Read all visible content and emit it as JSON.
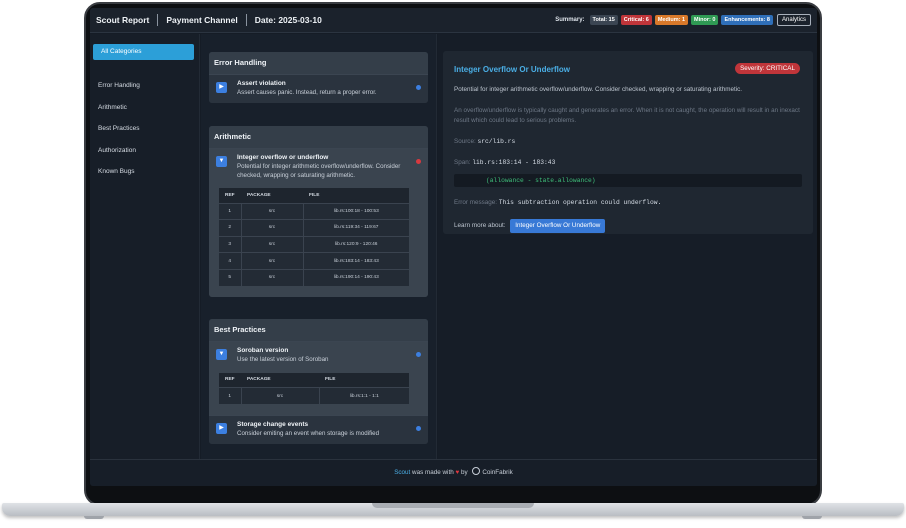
{
  "header": {
    "title": "Scout Report",
    "project": "Payment Channel",
    "date": "Date: 2025-03-10",
    "summary_label": "Summary:",
    "badges": {
      "total": "Total: 15",
      "critical": "Critical: 6",
      "medium": "Medium: 1",
      "minor": "Minor: 0",
      "enhancements": "Enhancements: 8"
    },
    "analytics_label": "Analytics"
  },
  "sidebar": {
    "active": "All Categories",
    "items": [
      "Error Handling",
      "Arithmetic",
      "Best Practices",
      "Authorization",
      "Known Bugs"
    ]
  },
  "categories": [
    {
      "title": "Error Handling",
      "issues": [
        {
          "name": "Assert violation",
          "desc": "Assert causes panic. Instead, return a proper error.",
          "severity_color": "#3c7fe0"
        }
      ]
    },
    {
      "title": "Arithmetic",
      "issues": [
        {
          "name": "Integer overflow or underflow",
          "desc": "Potential for integer arithmetic overflow/underflow. Consider checked, wrapping or saturating arithmetic.",
          "severity_color": "#d8393f",
          "table": {
            "headers": [
              "REF",
              "PACKAGE",
              "FILE"
            ],
            "rows": [
              [
                "1",
                "src",
                "lib.rs:100:18 - 100:53"
              ],
              [
                "2",
                "src",
                "lib.rs:119:34 - 119:67"
              ],
              [
                "3",
                "src",
                "lib.rs:120:9 - 120:46"
              ],
              [
                "4",
                "src",
                "lib.rs:183:14 - 183:43"
              ],
              [
                "5",
                "src",
                "lib.rs:190:14 - 190:43"
              ]
            ]
          }
        }
      ]
    },
    {
      "title": "Best Practices",
      "issues": [
        {
          "name": "Soroban version",
          "desc": "Use the latest version of Soroban",
          "severity_color": "#3c7fe0",
          "table": {
            "headers": [
              "REF",
              "PACKAGE",
              "FILE"
            ],
            "rows": [
              [
                "1",
                "src",
                "lib.rs:1:1 - 1:1"
              ]
            ]
          }
        },
        {
          "name": "Storage change events",
          "desc": "Consider emiting an event when storage is modified",
          "severity_color": "#3c7fe0"
        }
      ]
    }
  ],
  "detail": {
    "title": "Integer Overflow Or Underflow",
    "severity": "Severity: CRITICAL",
    "summary": "Potential for integer arithmetic overflow/underflow. Consider checked, wrapping or saturating arithmetic.",
    "explanation": "An overflow/underflow is typically caught and generates an error. When it is not caught, the operation will result in an inexact result which could lead to serious problems.",
    "source_label": "Source:",
    "source": "src/lib.rs",
    "span_label": "Span:",
    "span": "lib.rs:183:14 - 183:43",
    "code": "(allowance - state.allowance)",
    "error_label": "Error message:",
    "error": "This subtraction operation could underflow.",
    "learn_label": "Learn more about:",
    "learn_link": "Integer Overflow Or Underflow"
  },
  "footer": {
    "brand": "Scout",
    "text1": "was made with",
    "text2": "by",
    "company": "CoinFabrik"
  },
  "colors": {
    "critical": "#c0353a",
    "medium": "#d9792a",
    "minor": "#2f9a54",
    "enhancement": "#2f6fb9",
    "accent": "#2c9fd8"
  }
}
